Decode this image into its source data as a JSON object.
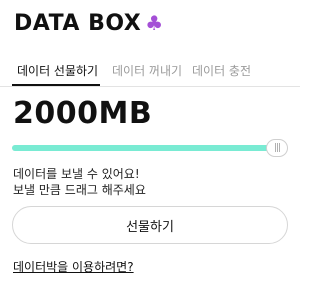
{
  "brand": {
    "title": "DATA BOX",
    "logo_icon": "clover-icon",
    "logo_color": "#a44fd6"
  },
  "tabs": [
    {
      "label": "데이터 선물하기",
      "active": true
    },
    {
      "label": "데이터 꺼내기",
      "active": false
    },
    {
      "label": "데이터 충전",
      "active": false
    }
  ],
  "amount": {
    "value": "2000MB"
  },
  "slider": {
    "fraction": 0.98,
    "fill_color": "#79ebd3"
  },
  "description": {
    "line1": "데이터를 보낼 수 있어요!",
    "line2": "보낼 만큼 드래그 해주세요"
  },
  "gift_button": {
    "label": "선물하기"
  },
  "help_link": {
    "label": "데이터박을 이용하려면?"
  }
}
